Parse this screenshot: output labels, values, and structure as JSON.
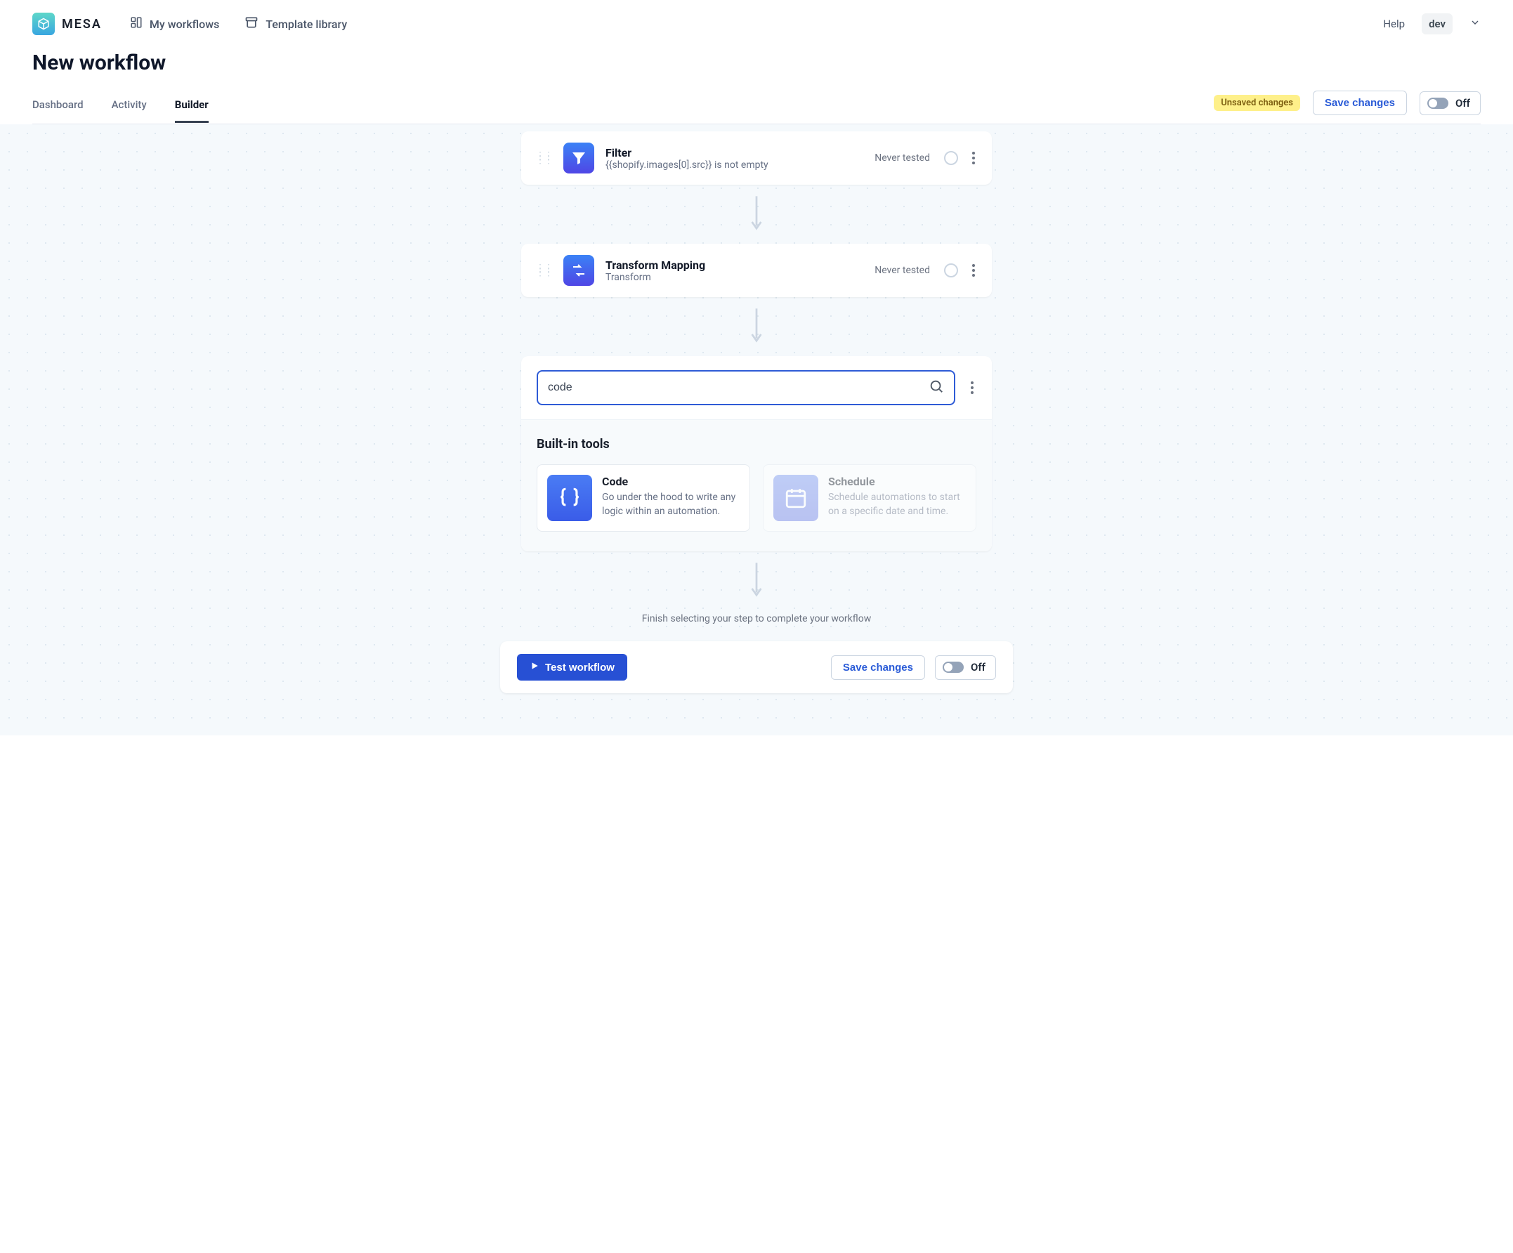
{
  "brand": {
    "name": "MESA"
  },
  "nav": {
    "my_workflows": "My workflows",
    "template_library": "Template library"
  },
  "header": {
    "help": "Help",
    "env": "dev"
  },
  "page": {
    "title": "New workflow"
  },
  "tabs": {
    "dashboard": "Dashboard",
    "activity": "Activity",
    "builder": "Builder"
  },
  "tabActions": {
    "unsaved": "Unsaved changes",
    "save": "Save changes",
    "toggle": "Off"
  },
  "steps": [
    {
      "title": "Filter",
      "subtitle": "{{shopify.images[0].src}} is not empty",
      "status": "Never tested"
    },
    {
      "title": "Transform Mapping",
      "subtitle": "Transform",
      "status": "Never tested"
    }
  ],
  "picker": {
    "search_value": "code",
    "section_title": "Built-in tools",
    "tools": [
      {
        "title": "Code",
        "desc": "Go under the hood to write any logic within an automation."
      },
      {
        "title": "Schedule",
        "desc": "Schedule automations to start on a specific date and time."
      }
    ]
  },
  "hint": "Finish selecting your step to complete your workflow",
  "bottom": {
    "test": "Test workflow",
    "save": "Save changes",
    "toggle": "Off"
  }
}
